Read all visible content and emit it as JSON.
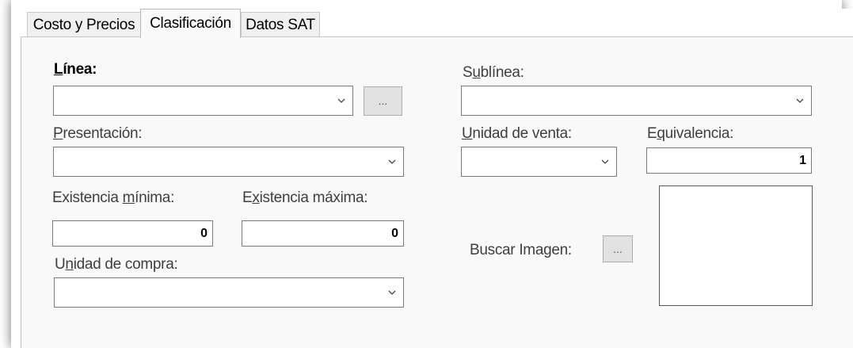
{
  "tabs": {
    "costo": "Costo y Precios",
    "clasificacion": "Clasificación",
    "datos_sat": "Datos SAT"
  },
  "fields": {
    "linea": {
      "label_a": "L",
      "label_b": "ínea:",
      "value": ""
    },
    "sublinea": {
      "label_a": "S",
      "label_b": "u",
      "label_c": "blínea:",
      "value": ""
    },
    "presentacion": {
      "label_a": "P",
      "label_b": "resentación:",
      "value": ""
    },
    "unidad_venta": {
      "label_a": "U",
      "label_b": "nidad de venta:",
      "value": ""
    },
    "equivalencia": {
      "label_a": "E",
      "label_b": "q",
      "label_c": "uivalencia:",
      "value": "1"
    },
    "existencia_min": {
      "label_a": "Existencia ",
      "label_b": "m",
      "label_c": "ínima:",
      "value": "0"
    },
    "existencia_max": {
      "label_a": "E",
      "label_b": "x",
      "label_c": "istencia máxima:",
      "value": "0"
    },
    "unidad_compra": {
      "label_a": "U",
      "label_b": "n",
      "label_c": "idad de compra:",
      "value": ""
    },
    "buscar_imagen": {
      "label": "Buscar Imagen:"
    }
  },
  "buttons": {
    "browse_linea": "...",
    "browse_imagen": "..."
  },
  "icons": {
    "dropdown": "chevron-down-icon"
  }
}
